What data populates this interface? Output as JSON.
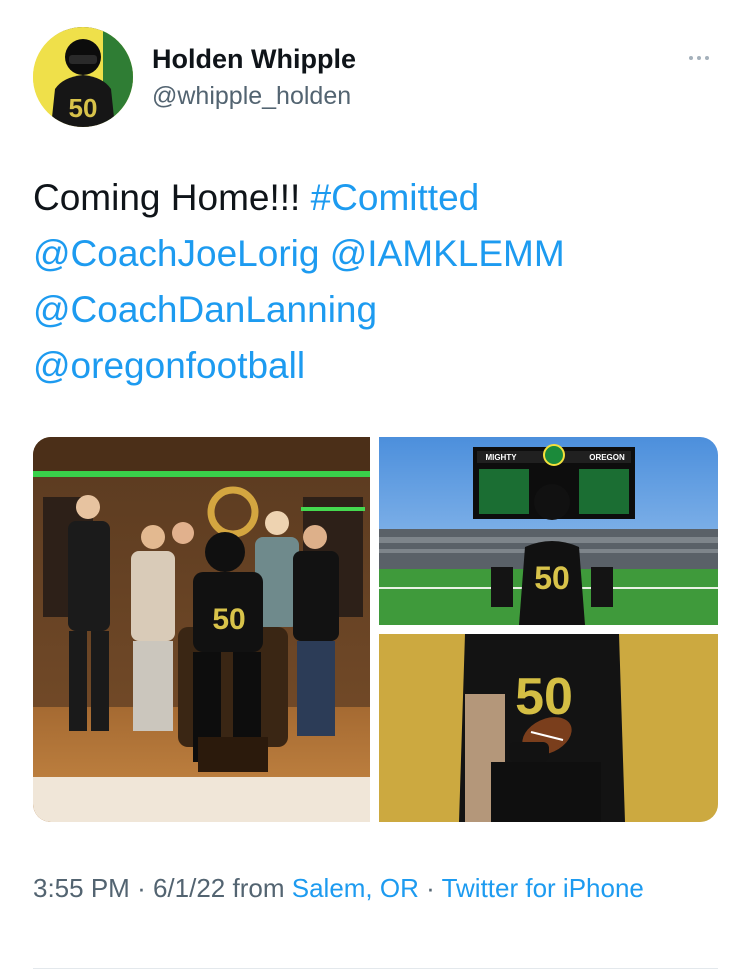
{
  "author": {
    "display_name": "Holden Whipple",
    "handle": "@whipple_holden",
    "avatar_icon": "profile-photo-football-player"
  },
  "tweet": {
    "text_plain": "Coming Home!!!",
    "hashtag": "#Comitted",
    "mentions": [
      "@CoachJoeLorig",
      "@IAMKLEMM",
      "@CoachDanLanning",
      "@oregonfootball"
    ]
  },
  "media": [
    {
      "label": "group-photo-locker-room"
    },
    {
      "label": "stadium-photo",
      "scoreboard_left": "MIGHTY",
      "scoreboard_right": "OREGON",
      "jersey_number": "50"
    },
    {
      "label": "studio-photo-holding-football",
      "jersey_number": "50"
    }
  ],
  "meta": {
    "time": "3:55 PM",
    "separator": "·",
    "date": "6/1/22",
    "from_label": "from",
    "location": "Salem, OR",
    "source": "Twitter for iPhone"
  },
  "colors": {
    "link": "#1d9bf0",
    "secondary_text": "#536471",
    "oregon_green": "#154733",
    "oregon_yellow": "#fee123"
  }
}
